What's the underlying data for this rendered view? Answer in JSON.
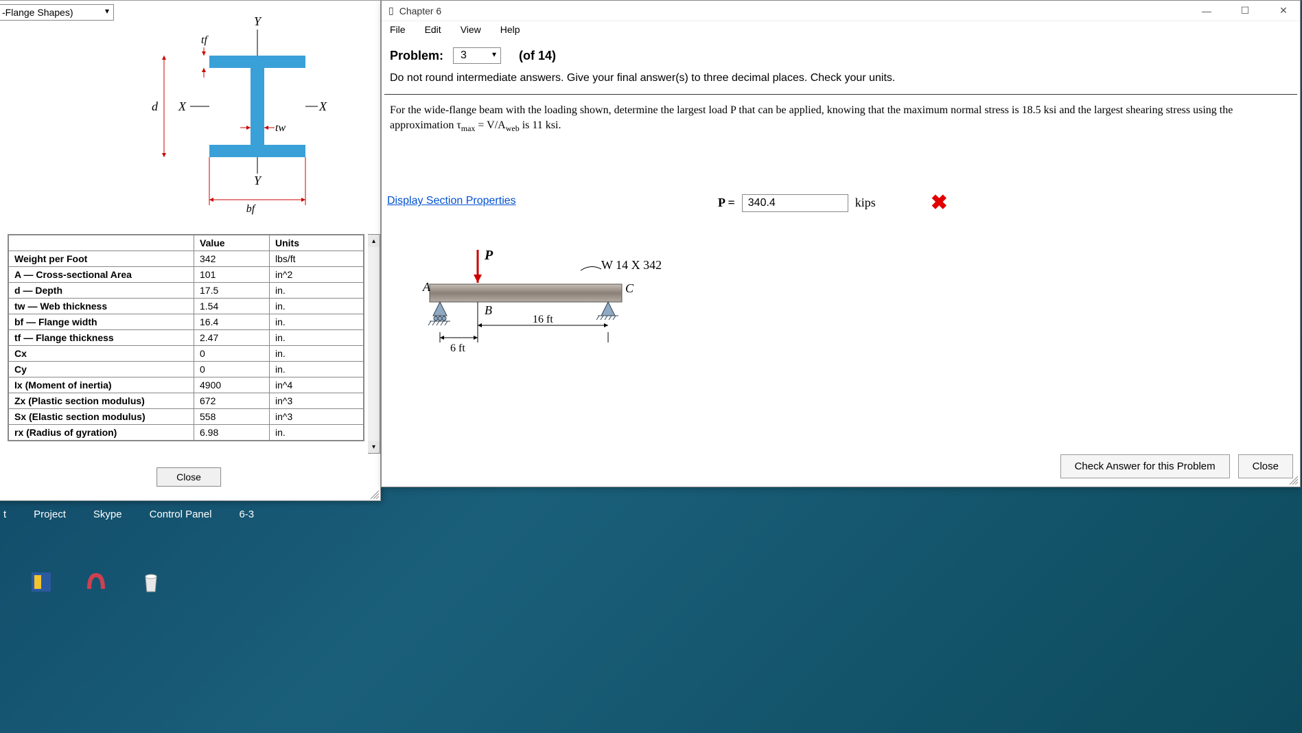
{
  "prop_window": {
    "shape_selector": "-Flange Shapes)",
    "diagram_labels": {
      "Y_top": "Y",
      "Y_bot": "Y",
      "X_left": "X",
      "X_right": "X",
      "d": "d",
      "tf": "tf",
      "tw": "tw",
      "bf": "bf"
    },
    "headers": {
      "value": "Value",
      "units": "Units"
    },
    "rows": [
      {
        "label": "Weight per Foot",
        "value": "342",
        "units": "lbs/ft"
      },
      {
        "label": "A — Cross-sectional Area",
        "value": "101",
        "units": "in^2"
      },
      {
        "label": "d — Depth",
        "value": "17.5",
        "units": "in."
      },
      {
        "label": "tw — Web thickness",
        "value": "1.54",
        "units": "in."
      },
      {
        "label": "bf — Flange width",
        "value": "16.4",
        "units": "in."
      },
      {
        "label": "tf — Flange thickness",
        "value": "2.47",
        "units": "in."
      },
      {
        "label": "Cx",
        "value": "0",
        "units": "in."
      },
      {
        "label": "Cy",
        "value": "0",
        "units": "in."
      },
      {
        "label": "Ix (Moment of inertia)",
        "value": "4900",
        "units": "in^4"
      },
      {
        "label": "Zx (Plastic section modulus)",
        "value": "672",
        "units": "in^3"
      },
      {
        "label": "Sx (Elastic section modulus)",
        "value": "558",
        "units": "in^3"
      },
      {
        "label": "rx (Radius of gyration)",
        "value": "6.98",
        "units": "in."
      }
    ],
    "close_label": "Close"
  },
  "main_window": {
    "title": "Chapter 6",
    "menu": {
      "file": "File",
      "edit": "Edit",
      "view": "View",
      "help": "Help"
    },
    "problem_label": "Problem:",
    "problem_number": "3",
    "of_label": "(of 14)",
    "instructions": "Do not round intermediate answers.  Give your final answer(s) to three decimal places.  Check your units.",
    "prompt_1": "For the wide-flange beam with the loading shown, determine the largest load P that can be applied, knowing that the maximum normal stress is 18.5 ksi and the largest shearing stress using the approximation τ",
    "prompt_sub": "max",
    "prompt_2": " = V/A",
    "prompt_sub2": "web",
    "prompt_3": " is 11 ksi.",
    "display_link": "Display Section Properties",
    "beam": {
      "P": "P",
      "A": "A",
      "B": "B",
      "C": "C",
      "section": "W 14 X 342",
      "span1": "6 ft",
      "span2": "16 ft"
    },
    "answer": {
      "label": "P = ",
      "value": "340.4",
      "units": "kips"
    },
    "check_button": "Check Answer for this Problem",
    "close_button": "Close"
  },
  "taskbar": {
    "t": "t",
    "project": "Project",
    "skype": "Skype",
    "control_panel": "Control Panel",
    "six3": "6-3"
  }
}
